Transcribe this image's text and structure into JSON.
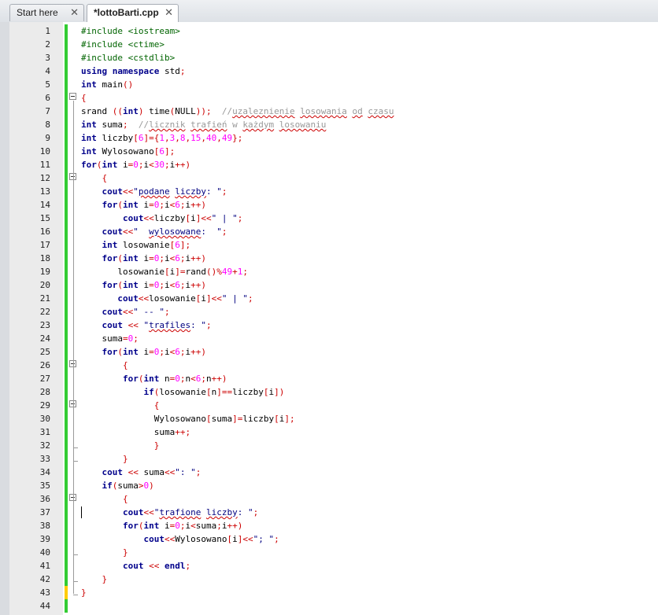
{
  "tabs": [
    {
      "label": "Start here",
      "close": "✕",
      "active": false
    },
    {
      "label": "*lottoBarti.cpp",
      "close": "✕",
      "active": true
    }
  ],
  "editor": {
    "cursor_line": 37,
    "lines": [
      {
        "n": "1",
        "html": "<span class=\"pp\">#include &lt;iostream&gt;</span>"
      },
      {
        "n": "2",
        "html": "<span class=\"pp\">#include &lt;ctime&gt;</span>"
      },
      {
        "n": "3",
        "html": "<span class=\"pp\">#include &lt;cstdlib&gt;</span>"
      },
      {
        "n": "4",
        "html": "<span class=\"kw\">using namespace</span> std<span class=\"op\">;</span>"
      },
      {
        "n": "5",
        "html": "<span class=\"kw\">int</span> main<span class=\"op\">()</span>"
      },
      {
        "n": "6",
        "html": "<span class=\"op\">{</span>",
        "fold": true
      },
      {
        "n": "7",
        "html": "srand <span class=\"op\">((</span><span class=\"kw\">int</span><span class=\"op\">)</span> time<span class=\"op\">(</span>NULL<span class=\"op\">));</span>  <span class=\"cm\">//<span class=\"squig\">uzaleznienie</span> <span class=\"squig\">losowania</span> <span class=\"squig\">od</span> <span class=\"squig\">czasu</span></span>"
      },
      {
        "n": "8",
        "html": "<span class=\"kw\">int</span> suma<span class=\"op\">;</span>  <span class=\"cm\">//<span class=\"squig\">licznik</span> <span class=\"squig\">trafień</span> w <span class=\"squig\">każdym</span> <span class=\"squig\">losowaniu</span></span>"
      },
      {
        "n": "9",
        "html": "<span class=\"kw\">int</span> liczby<span class=\"op\">[</span><span class=\"num\">6</span><span class=\"op\">]={</span><span class=\"num\">1</span><span class=\"op\">,</span><span class=\"num\">3</span><span class=\"op\">,</span><span class=\"num\">8</span><span class=\"op\">,</span><span class=\"num\">15</span><span class=\"op\">,</span><span class=\"num\">40</span><span class=\"op\">,</span><span class=\"num\">49</span><span class=\"op\">};</span>"
      },
      {
        "n": "10",
        "html": "<span class=\"kw\">int</span> Wylosowano<span class=\"op\">[</span><span class=\"num\">6</span><span class=\"op\">];</span>"
      },
      {
        "n": "11",
        "html": "<span class=\"kw\">for</span><span class=\"op\">(</span><span class=\"kw\">int</span> i<span class=\"op\">=</span><span class=\"num\">0</span><span class=\"op\">;</span>i<span class=\"op\">&lt;</span><span class=\"num\">30</span><span class=\"op\">;</span>i<span class=\"op\">++)</span>"
      },
      {
        "n": "12",
        "html": "    <span class=\"op\">{</span>",
        "fold": true
      },
      {
        "n": "13",
        "html": "    <span class=\"kw\">cout</span><span class=\"op\">&lt;&lt;</span><span class=\"str\">\"<span class=\"squig\">podane</span> <span class=\"squig\">liczby</span>: \"</span><span class=\"op\">;</span>"
      },
      {
        "n": "14",
        "html": "    <span class=\"kw\">for</span><span class=\"op\">(</span><span class=\"kw\">int</span> i<span class=\"op\">=</span><span class=\"num\">0</span><span class=\"op\">;</span>i<span class=\"op\">&lt;</span><span class=\"num\">6</span><span class=\"op\">;</span>i<span class=\"op\">++)</span>"
      },
      {
        "n": "15",
        "html": "        <span class=\"kw\">cout</span><span class=\"op\">&lt;&lt;</span>liczby<span class=\"op\">[</span>i<span class=\"op\">]&lt;&lt;</span><span class=\"str\">\" | \"</span><span class=\"op\">;</span>"
      },
      {
        "n": "16",
        "html": "    <span class=\"kw\">cout</span><span class=\"op\">&lt;&lt;</span><span class=\"str\">\"  <span class=\"squig\">wylosowane</span>:  \"</span><span class=\"op\">;</span>"
      },
      {
        "n": "17",
        "html": "    <span class=\"kw\">int</span> losowanie<span class=\"op\">[</span><span class=\"num\">6</span><span class=\"op\">];</span>"
      },
      {
        "n": "18",
        "html": "    <span class=\"kw\">for</span><span class=\"op\">(</span><span class=\"kw\">int</span> i<span class=\"op\">=</span><span class=\"num\">0</span><span class=\"op\">;</span>i<span class=\"op\">&lt;</span><span class=\"num\">6</span><span class=\"op\">;</span>i<span class=\"op\">++)</span>"
      },
      {
        "n": "19",
        "html": "       losowanie<span class=\"op\">[</span>i<span class=\"op\">]=</span>rand<span class=\"op\">()%</span><span class=\"num\">49</span><span class=\"op\">+</span><span class=\"num\">1</span><span class=\"op\">;</span>"
      },
      {
        "n": "20",
        "html": "    <span class=\"kw\">for</span><span class=\"op\">(</span><span class=\"kw\">int</span> i<span class=\"op\">=</span><span class=\"num\">0</span><span class=\"op\">;</span>i<span class=\"op\">&lt;</span><span class=\"num\">6</span><span class=\"op\">;</span>i<span class=\"op\">++)</span>"
      },
      {
        "n": "21",
        "html": "       <span class=\"kw\">cout</span><span class=\"op\">&lt;&lt;</span>losowanie<span class=\"op\">[</span>i<span class=\"op\">]&lt;&lt;</span><span class=\"str\">\" | \"</span><span class=\"op\">;</span>"
      },
      {
        "n": "22",
        "html": "    <span class=\"kw\">cout</span><span class=\"op\">&lt;&lt;</span><span class=\"str\">\" -- \"</span><span class=\"op\">;</span>"
      },
      {
        "n": "23",
        "html": "    <span class=\"kw\">cout</span> <span class=\"op\">&lt;&lt;</span> <span class=\"str\">\"<span class=\"squig\">trafiles</span>: \"</span><span class=\"op\">;</span>"
      },
      {
        "n": "24",
        "html": "    suma<span class=\"op\">=</span><span class=\"num\">0</span><span class=\"op\">;</span>"
      },
      {
        "n": "25",
        "html": "    <span class=\"kw\">for</span><span class=\"op\">(</span><span class=\"kw\">int</span> i<span class=\"op\">=</span><span class=\"num\">0</span><span class=\"op\">;</span>i<span class=\"op\">&lt;</span><span class=\"num\">6</span><span class=\"op\">;</span>i<span class=\"op\">++)</span>"
      },
      {
        "n": "26",
        "html": "        <span class=\"op\">{</span>",
        "fold": true
      },
      {
        "n": "27",
        "html": "        <span class=\"kw\">for</span><span class=\"op\">(</span><span class=\"kw\">int</span> n<span class=\"op\">=</span><span class=\"num\">0</span><span class=\"op\">;</span>n<span class=\"op\">&lt;</span><span class=\"num\">6</span><span class=\"op\">;</span>n<span class=\"op\">++)</span>"
      },
      {
        "n": "28",
        "html": "            <span class=\"kw\">if</span><span class=\"op\">(</span>losowanie<span class=\"op\">[</span>n<span class=\"op\">]==</span>liczby<span class=\"op\">[</span>i<span class=\"op\">])</span>"
      },
      {
        "n": "29",
        "html": "              <span class=\"op\">{</span>",
        "fold": true
      },
      {
        "n": "30",
        "html": "              Wylosowano<span class=\"op\">[</span>suma<span class=\"op\">]=</span>liczby<span class=\"op\">[</span>i<span class=\"op\">];</span>"
      },
      {
        "n": "31",
        "html": "              suma<span class=\"op\">++;</span>"
      },
      {
        "n": "32",
        "html": "              <span class=\"op\">}</span>",
        "foldend": true
      },
      {
        "n": "33",
        "html": "        <span class=\"op\">}</span>",
        "foldend": true
      },
      {
        "n": "34",
        "html": "    <span class=\"kw\">cout</span> <span class=\"op\">&lt;&lt;</span> suma<span class=\"op\">&lt;&lt;</span><span class=\"str\">\": \"</span><span class=\"op\">;</span>"
      },
      {
        "n": "35",
        "html": "    <span class=\"kw\">if</span><span class=\"op\">(</span>suma<span class=\"op\">&gt;</span><span class=\"num\">0</span><span class=\"op\">)</span>"
      },
      {
        "n": "36",
        "html": "        <span class=\"op\">{</span>",
        "fold": true
      },
      {
        "n": "37",
        "html": "        <span class=\"kw\">cout</span><span class=\"op\">&lt;&lt;</span><span class=\"str\">\"<span class=\"squig\">trafione</span> <span class=\"squig\">liczby</span>: \"</span><span class=\"op\">;</span>"
      },
      {
        "n": "38",
        "html": "        <span class=\"kw\">for</span><span class=\"op\">(</span><span class=\"kw\">int</span> i<span class=\"op\">=</span><span class=\"num\">0</span><span class=\"op\">;</span>i<span class=\"op\">&lt;</span>suma<span class=\"op\">;</span>i<span class=\"op\">++)</span>"
      },
      {
        "n": "39",
        "html": "            <span class=\"kw\">cout</span><span class=\"op\">&lt;&lt;</span>Wylosowano<span class=\"op\">[</span>i<span class=\"op\">]&lt;&lt;</span><span class=\"str\">\"; \"</span><span class=\"op\">;</span>"
      },
      {
        "n": "40",
        "html": "        <span class=\"op\">}</span>",
        "foldend": true
      },
      {
        "n": "41",
        "html": "        <span class=\"kw\">cout</span> <span class=\"op\">&lt;&lt;</span> <span class=\"kw\">endl</span><span class=\"op\">;</span>"
      },
      {
        "n": "42",
        "html": "    <span class=\"op\">}</span>",
        "foldend": true
      },
      {
        "n": "43",
        "html": "<span class=\"op\">}</span>",
        "foldend": true,
        "modified": true
      },
      {
        "n": "44",
        "html": ""
      }
    ],
    "colors": {
      "saved_bar": "#33cc33",
      "modified_bar": "#ffcc00"
    }
  }
}
